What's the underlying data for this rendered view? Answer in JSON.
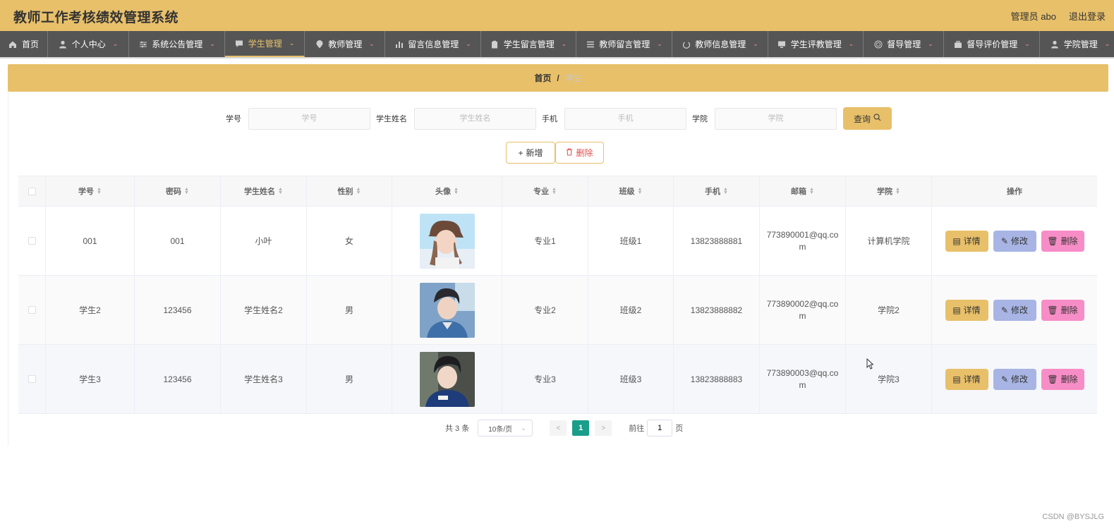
{
  "app": {
    "title": "教师工作考核绩效管理系统",
    "user_label": "管理员 abo",
    "logout_label": "退出登录"
  },
  "nav": [
    {
      "label": "首页",
      "icon": "home-icon",
      "caret": false
    },
    {
      "label": "个人中心",
      "icon": "person-icon",
      "caret": true
    },
    {
      "label": "系统公告管理",
      "icon": "sliders-icon",
      "caret": true
    },
    {
      "label": "学生管理",
      "icon": "chat-icon",
      "caret": true,
      "active": true
    },
    {
      "label": "教师管理",
      "icon": "location-icon",
      "caret": true
    },
    {
      "label": "留言信息管理",
      "icon": "bar-chart-icon",
      "caret": true
    },
    {
      "label": "学生留言管理",
      "icon": "clipboard-icon",
      "caret": true
    },
    {
      "label": "教师留言管理",
      "icon": "list-icon",
      "caret": true
    },
    {
      "label": "教师信息管理",
      "icon": "power-icon",
      "caret": true
    },
    {
      "label": "学生评教管理",
      "icon": "monitor-icon",
      "caret": true
    },
    {
      "label": "督导管理",
      "icon": "target-icon",
      "caret": true
    },
    {
      "label": "督导评价管理",
      "icon": "briefcase-icon",
      "caret": true
    },
    {
      "label": "学院管理",
      "icon": "user-icon",
      "caret": true
    }
  ],
  "breadcrumb": {
    "home": "首页",
    "separator": "/",
    "current": "学生"
  },
  "search": {
    "fields": [
      {
        "label": "学号",
        "placeholder": "学号",
        "value": ""
      },
      {
        "label": "学生姓名",
        "placeholder": "学生姓名",
        "value": ""
      },
      {
        "label": "手机",
        "placeholder": "手机",
        "value": ""
      },
      {
        "label": "学院",
        "placeholder": "学院",
        "value": ""
      }
    ],
    "query_label": "查询"
  },
  "actions": {
    "add_label": "新增",
    "delete_label": "删除"
  },
  "table": {
    "columns": [
      "学号",
      "密码",
      "学生姓名",
      "性别",
      "头像",
      "专业",
      "班级",
      "手机",
      "邮箱",
      "学院",
      "操作"
    ],
    "rows": [
      {
        "id": "001",
        "password": "001",
        "name": "小叶",
        "gender": "女",
        "major": "专业1",
        "class": "班级1",
        "phone": "13823888881",
        "email": "773890001@qq.com",
        "college": "计算机学院"
      },
      {
        "id": "学生2",
        "password": "123456",
        "name": "学生姓名2",
        "gender": "男",
        "major": "专业2",
        "class": "班级2",
        "phone": "13823888882",
        "email": "773890002@qq.com",
        "college": "学院2"
      },
      {
        "id": "学生3",
        "password": "123456",
        "name": "学生姓名3",
        "gender": "男",
        "major": "专业3",
        "class": "班级3",
        "phone": "13823888883",
        "email": "773890003@qq.com",
        "college": "学院3"
      }
    ],
    "row_actions": {
      "detail": "详情",
      "edit": "修改",
      "remove": "删除"
    }
  },
  "pagination": {
    "total_label": "共 3 条",
    "page_size": "10条/页",
    "current_page": "1",
    "goto_label": "前往",
    "goto_value": "1",
    "page_suffix": "页"
  },
  "watermark": "CSDN @BYSJLG",
  "colors": {
    "accent": "#e8c06a",
    "nav_bg": "#555555",
    "page_active": "#1a9e8a",
    "edit": "#a7b4e4",
    "remove": "#f78dc6"
  }
}
